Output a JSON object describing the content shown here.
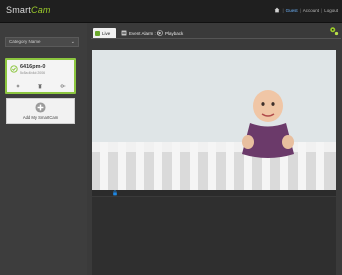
{
  "header": {
    "brand_prefix": "Smart",
    "brand_accent": "Cam",
    "nav": {
      "home_icon": "home-icon",
      "guest": "Guest",
      "account": "Account",
      "logout": "Logout"
    }
  },
  "sidebar": {
    "category_select": "Category Name",
    "camera": {
      "name": "6416pm-0",
      "subtitle": "5c5a:4b4d:2006"
    },
    "add_label": "Add My SmartCam"
  },
  "tabs": [
    {
      "label": "Live"
    },
    {
      "label": "Event Alarm : 0"
    },
    {
      "label": "Playback"
    }
  ],
  "colors": {
    "accent": "#8cc63f",
    "link": "#6fb6ff",
    "lock": "#1e88e5"
  }
}
